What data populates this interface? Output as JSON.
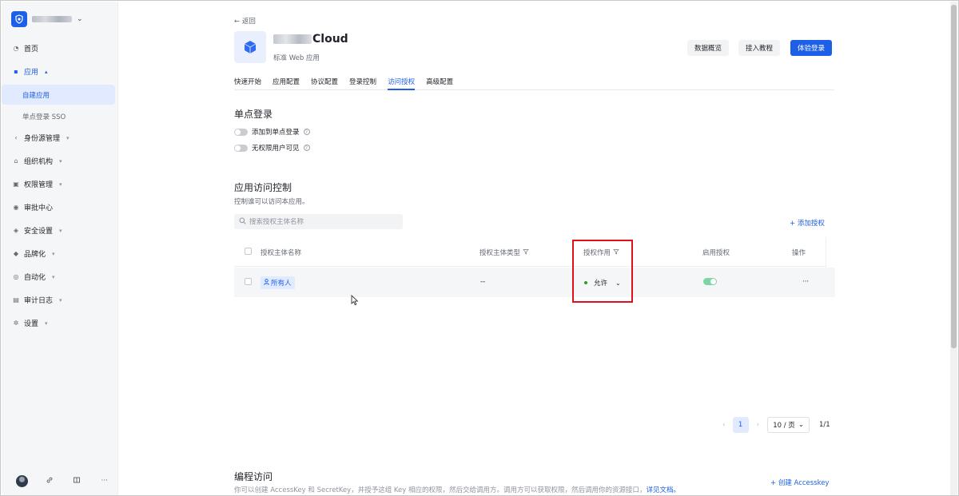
{
  "sidebar": {
    "brand_caret": "⌄",
    "items": [
      {
        "label": "首页",
        "icon": "pie-chart-icon"
      },
      {
        "label": "应用",
        "icon": "apps-icon",
        "open": true,
        "caret": "▴"
      },
      {
        "label": "身份源管理",
        "icon": "share-icon",
        "caret": "▾"
      },
      {
        "label": "组织机构",
        "icon": "org-icon",
        "caret": "▾"
      },
      {
        "label": "权限管理",
        "icon": "lock-icon",
        "caret": "▾"
      },
      {
        "label": "审批中心",
        "icon": "approval-icon"
      },
      {
        "label": "安全设置",
        "icon": "shield-icon",
        "caret": "▾"
      },
      {
        "label": "品牌化",
        "icon": "brand-icon",
        "caret": "▾"
      },
      {
        "label": "自动化",
        "icon": "automation-icon",
        "caret": "▾"
      },
      {
        "label": "审计日志",
        "icon": "audit-icon",
        "caret": "▾"
      },
      {
        "label": "设置",
        "icon": "gear-icon",
        "caret": "▾"
      }
    ],
    "sub_items": [
      {
        "label": "自建应用",
        "active": true
      },
      {
        "label": "单点登录 SSO",
        "active": false
      }
    ],
    "bottom_more": "···"
  },
  "header": {
    "back_label": "← 返回",
    "app_title": "Cloud",
    "app_subtitle": "标准 Web 应用",
    "buttons": {
      "overview": "数据概览",
      "tutorial": "接入教程",
      "trial_login": "体验登录"
    }
  },
  "tabs": [
    "快速开始",
    "应用配置",
    "协议配置",
    "登录控制",
    "访问授权",
    "高级配置"
  ],
  "active_tab": "访问授权",
  "sso_section": {
    "title": "单点登录",
    "toggles": [
      {
        "label": "添加到单点登录",
        "on": false
      },
      {
        "label": "无权限用户可见",
        "on": false
      }
    ],
    "help": "?"
  },
  "access_section": {
    "title": "应用访问控制",
    "description": "控制谁可以访问本应用。",
    "search_placeholder": "搜索授权主体名称",
    "add_label": "+ 添加授权",
    "columns": {
      "name": "授权主体名称",
      "type": "授权主体类型",
      "effect": "授权作用",
      "enabled": "启用授权",
      "actions": "操作"
    },
    "rows": [
      {
        "name": "所有人",
        "type": "--",
        "effect": "允许",
        "enabled": true,
        "more": "···"
      }
    ],
    "pagination": {
      "prev": "‹",
      "current": "1",
      "next": "›",
      "page_size": "10 / 页",
      "total": "1/1"
    }
  },
  "programmatic_section": {
    "title": "编程访问",
    "description": "你可以创建 AccessKey 和 SecretKey，并授予这组 Key 相应的权限，然后交给调用方。调用方可以获取权限，然后调用你的资源接口，",
    "doc_link": "详见文档。",
    "create_label": "+ 创建 Accesskey"
  },
  "colors": {
    "primary": "#1d5fe6",
    "highlight_box": "#e0101a",
    "allow_dot": "#2ea121"
  }
}
